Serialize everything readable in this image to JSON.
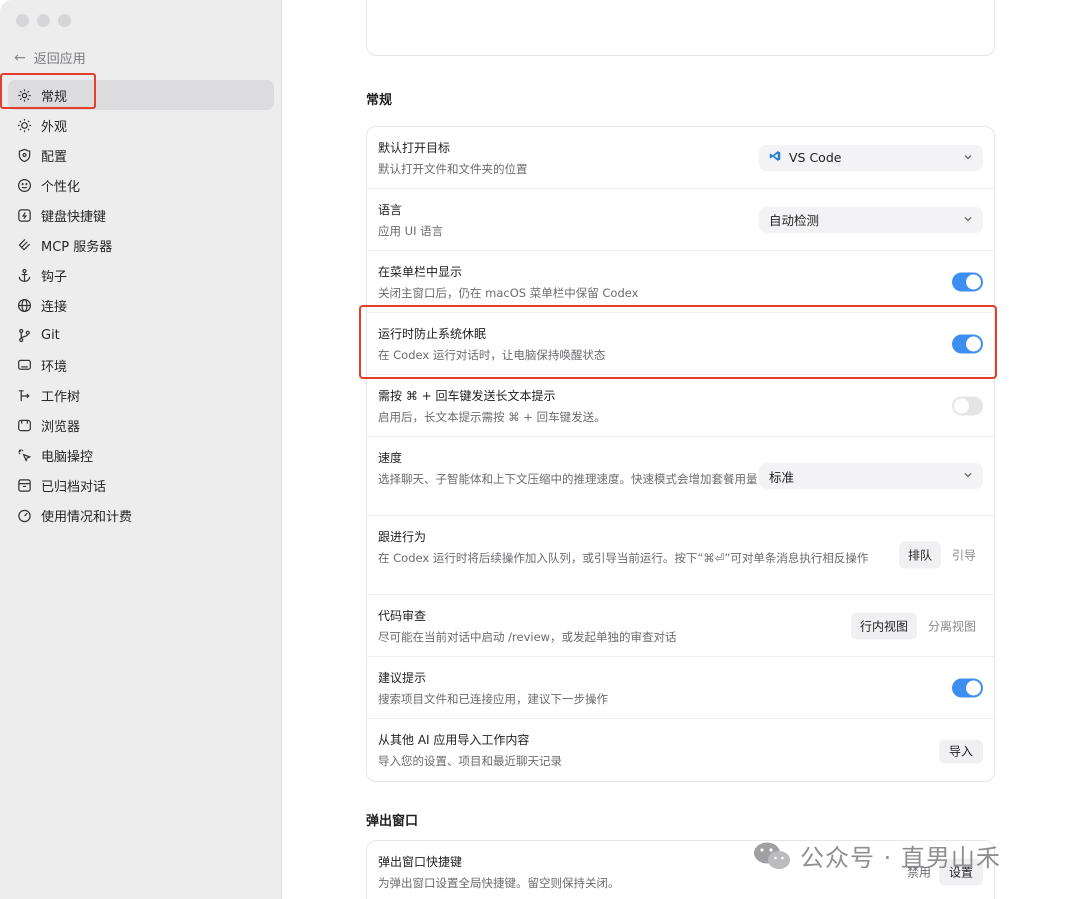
{
  "sidebar": {
    "back_label": "返回应用",
    "items": [
      {
        "label": "常规",
        "icon": "gear-icon"
      },
      {
        "label": "外观",
        "icon": "sun-icon"
      },
      {
        "label": "配置",
        "icon": "shield-icon"
      },
      {
        "label": "个性化",
        "icon": "smile-icon"
      },
      {
        "label": "键盘快捷键",
        "icon": "keyboard-icon"
      },
      {
        "label": "MCP 服务器",
        "icon": "mcp-icon"
      },
      {
        "label": "钩子",
        "icon": "anchor-icon"
      },
      {
        "label": "连接",
        "icon": "globe-icon"
      },
      {
        "label": "Git",
        "icon": "git-branch-icon"
      },
      {
        "label": "环境",
        "icon": "monitor-icon"
      },
      {
        "label": "工作树",
        "icon": "tree-icon"
      },
      {
        "label": "浏览器",
        "icon": "browser-icon"
      },
      {
        "label": "电脑操控",
        "icon": "cursor-icon"
      },
      {
        "label": "已归档对话",
        "icon": "archive-icon"
      },
      {
        "label": "使用情况和计费",
        "icon": "gauge-icon"
      }
    ]
  },
  "general": {
    "section_title": "常规",
    "rows": [
      {
        "title": "默认打开目标",
        "desc": "默认打开文件和文件夹的位置",
        "control": "select",
        "value": "VS Code"
      },
      {
        "title": "语言",
        "desc": "应用 UI 语言",
        "control": "select",
        "value": "自动检测"
      },
      {
        "title": "在菜单栏中显示",
        "desc": "关闭主窗口后，仍在 macOS 菜单栏中保留 Codex",
        "control": "toggle",
        "on": true
      },
      {
        "title": "运行时防止系统休眠",
        "desc": "在 Codex 运行对话时，让电脑保持唤醒状态",
        "control": "toggle",
        "on": true
      },
      {
        "title": "需按 ⌘ + 回车键发送长文本提示",
        "desc": "启用后，长文本提示需按 ⌘ + 回车键发送。",
        "control": "toggle",
        "on": false
      },
      {
        "title": "速度",
        "desc": "选择聊天、子智能体和上下文压缩中的推理速度。快速模式会增加套餐用量",
        "control": "select",
        "value": "标准"
      },
      {
        "title": "跟进行为",
        "desc": "在 Codex 运行时将后续操作加入队列，或引导当前运行。按下“⌘⏎”可对单条消息执行相反操作",
        "control": "segment",
        "options": [
          "排队",
          "引导"
        ]
      },
      {
        "title": "代码审查",
        "desc": "尽可能在当前对话中启动 /review，或发起单独的审查对话",
        "control": "segment",
        "options": [
          "行内视图",
          "分离视图"
        ]
      },
      {
        "title": "建议提示",
        "desc": "搜索项目文件和已连接应用，建议下一步操作",
        "control": "toggle",
        "on": true
      },
      {
        "title": "从其他 AI 应用导入工作内容",
        "desc": "导入您的设置、项目和最近聊天记录",
        "control": "button",
        "label": "导入"
      }
    ]
  },
  "popup": {
    "section_title": "弹出窗口",
    "row_title": "弹出窗口快捷键",
    "row_desc": "为弹出窗口设置全局快捷键。留空则保持关闭。",
    "disable_label": "禁用",
    "set_label": "设置"
  },
  "watermark": "公众号 · 直男山禾",
  "colors": {
    "accent": "#3d8ef2",
    "highlight": "#e0402c",
    "sidebar_bg": "#ededee"
  }
}
